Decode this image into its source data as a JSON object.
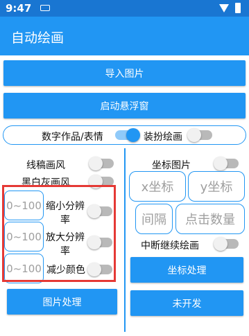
{
  "status": {
    "time": "9:47"
  },
  "app": {
    "title": "自动绘画"
  },
  "buttons": {
    "import_image": "导入图片",
    "start_float": "启动悬浮窗",
    "image_process": "图片处理",
    "coord_process": "坐标处理",
    "not_developed": "未开发"
  },
  "mode": {
    "digital_label": "数字作品/表情",
    "digital_on": true,
    "dressup_label": "装扮绘画",
    "dressup_on": false
  },
  "left": {
    "line_style": {
      "label": "线稿画风",
      "on": false
    },
    "bw_style": {
      "label": "黑白灰画风",
      "on": false
    },
    "shrink_res": {
      "label": "缩小分辨率",
      "placeholder": "0~100",
      "on": false
    },
    "enlarge_res": {
      "label": "放大分辨率",
      "placeholder": "0~100",
      "on": false
    },
    "reduce_color": {
      "label": "减少颜色",
      "placeholder": "0~100",
      "on": false
    }
  },
  "right": {
    "coord_image": {
      "label": "坐标图片",
      "on": false
    },
    "x_coord": "x坐标",
    "y_coord": "y坐标",
    "interval": "间隔",
    "click_count": "点击数量",
    "interrupt_continue": {
      "label": "中断继续绘画",
      "on": false
    }
  },
  "colors": {
    "appbar": "#2196f3",
    "statusbar": "#1976d2",
    "highlight": "#e53935"
  }
}
